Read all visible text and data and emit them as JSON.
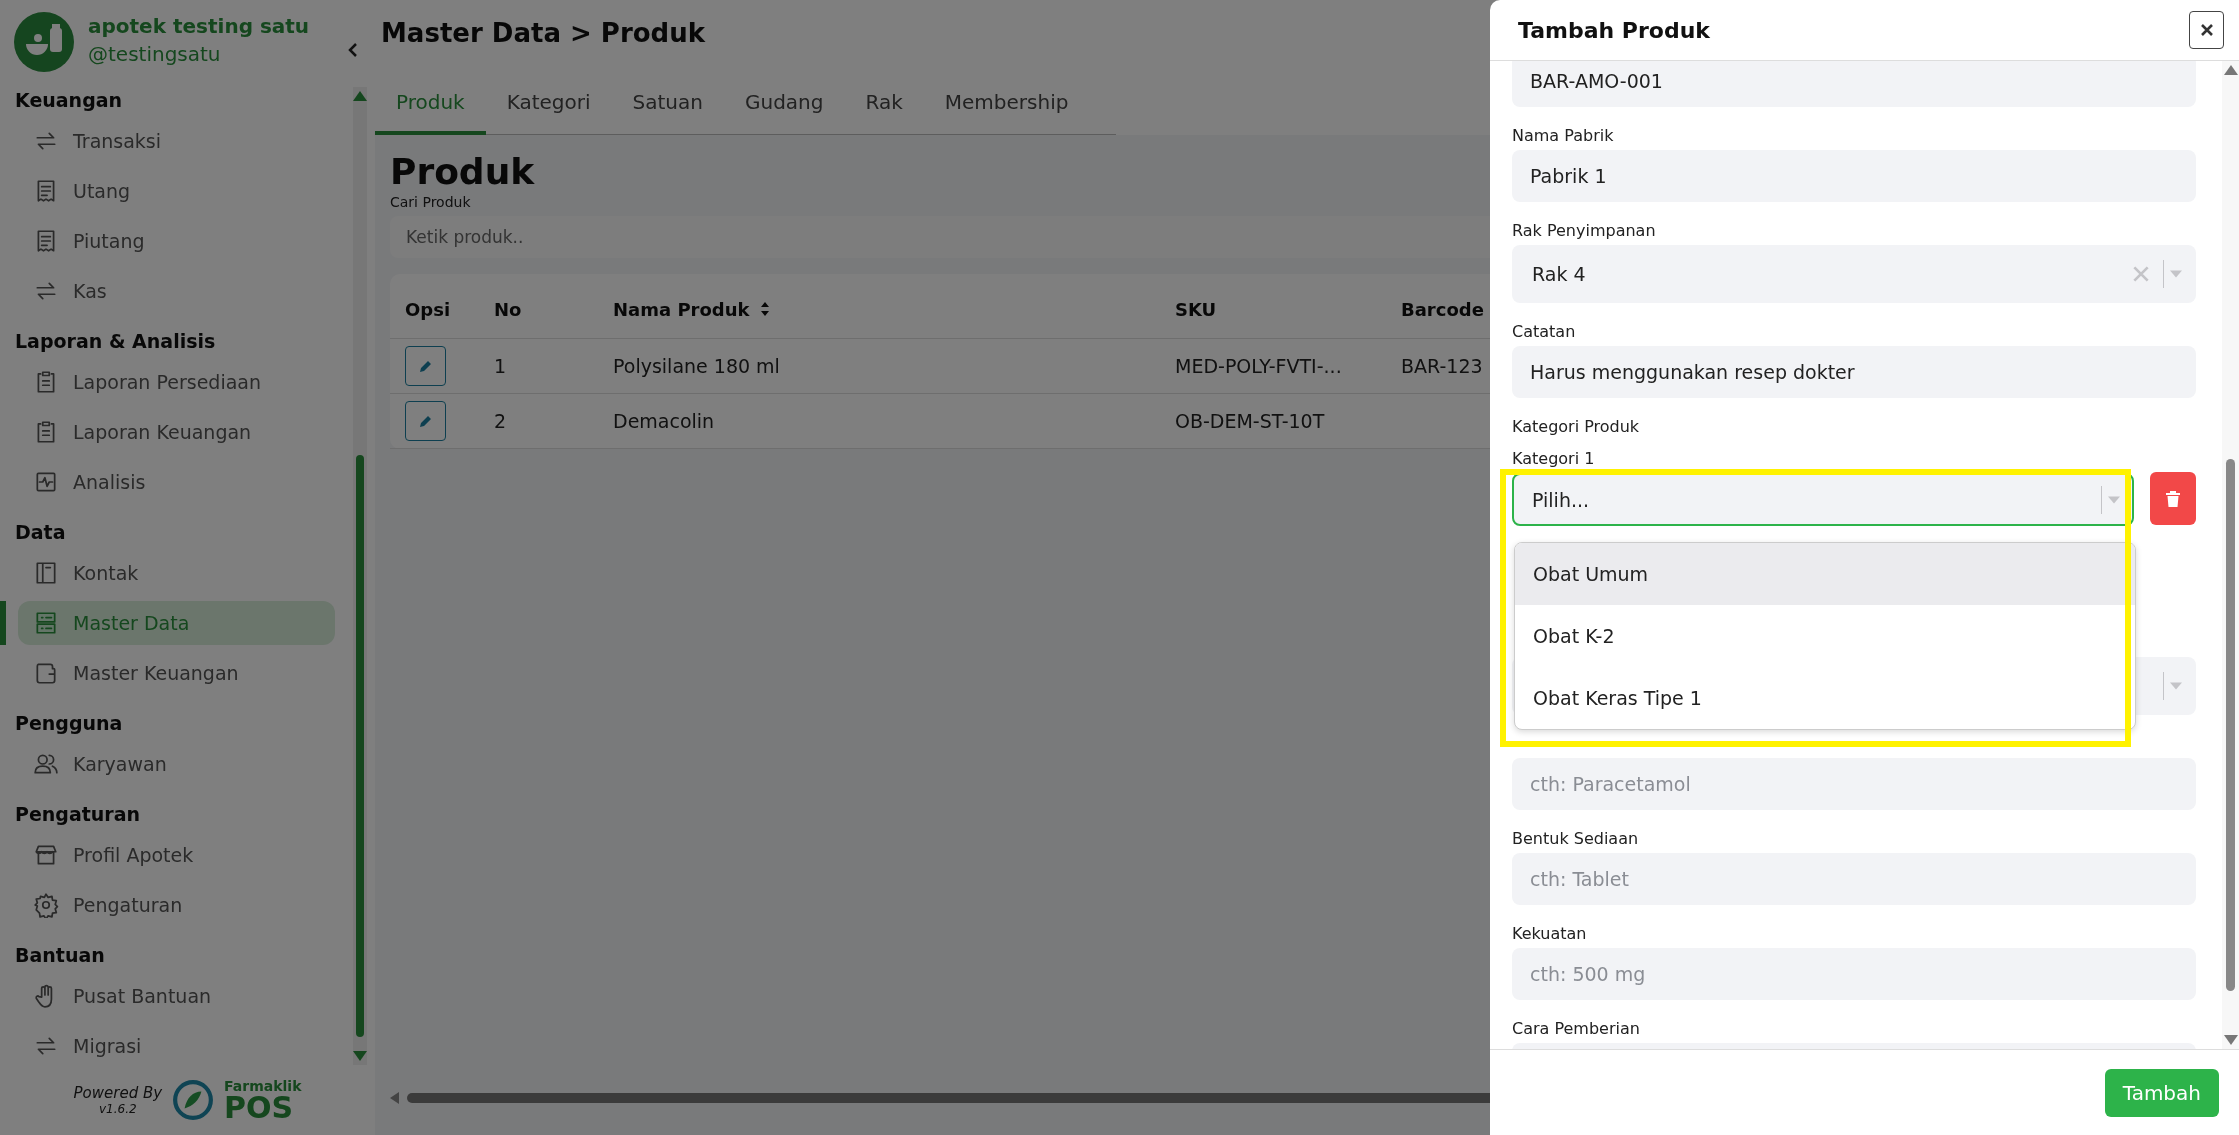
{
  "sidebar": {
    "brand": {
      "name": "apotek testing satu",
      "handle": "@testingsatu"
    },
    "sections": [
      {
        "title": "Keuangan",
        "items": [
          {
            "label": "Transaksi",
            "kind": "transfer",
            "selected": false
          },
          {
            "label": "Utang",
            "kind": "receipt",
            "selected": false
          },
          {
            "label": "Piutang",
            "kind": "receipt",
            "selected": false
          },
          {
            "label": "Kas",
            "kind": "transfer",
            "selected": false
          }
        ]
      },
      {
        "title": "Laporan & Analisis",
        "items": [
          {
            "label": "Laporan Persediaan",
            "kind": "clipboard",
            "selected": false
          },
          {
            "label": "Laporan Keuangan",
            "kind": "clipboard",
            "selected": false
          },
          {
            "label": "Analisis",
            "kind": "pulse",
            "selected": false
          }
        ]
      },
      {
        "title": "Data",
        "items": [
          {
            "label": "Kontak",
            "kind": "book",
            "selected": false
          },
          {
            "label": "Master Data",
            "kind": "database",
            "selected": true
          },
          {
            "label": "Master Keuangan",
            "kind": "wallet",
            "selected": false
          }
        ]
      },
      {
        "title": "Pengguna",
        "items": [
          {
            "label": "Karyawan",
            "kind": "users",
            "selected": false
          }
        ]
      },
      {
        "title": "Pengaturan",
        "items": [
          {
            "label": "Profil Apotek",
            "kind": "store",
            "selected": false
          },
          {
            "label": "Pengaturan",
            "kind": "gear",
            "selected": false
          }
        ]
      },
      {
        "title": "Bantuan",
        "items": [
          {
            "label": "Pusat Bantuan",
            "kind": "hand",
            "selected": false
          },
          {
            "label": "Migrasi",
            "kind": "transfer",
            "selected": false
          }
        ]
      }
    ],
    "footer": {
      "powered_by": "Powered By",
      "version": "v1.6.2",
      "logo_top": "Farmaklik",
      "logo_bottom": "POS"
    }
  },
  "page": {
    "breadcrumb": "Master Data > Produk",
    "tabs": [
      {
        "label": "Produk",
        "selected": true
      },
      {
        "label": "Kategori",
        "selected": false
      },
      {
        "label": "Satuan",
        "selected": false
      },
      {
        "label": "Gudang",
        "selected": false
      },
      {
        "label": "Rak",
        "selected": false
      },
      {
        "label": "Membership",
        "selected": false
      }
    ],
    "heading": "Produk",
    "search": {
      "label": "Cari Produk",
      "placeholder": "Ketik produk.."
    },
    "table": {
      "columns": [
        {
          "label": "Opsi",
          "sortable": false
        },
        {
          "label": "No",
          "sortable": false
        },
        {
          "label": "Nama Produk",
          "sortable": true
        },
        {
          "label": "SKU",
          "sortable": false
        },
        {
          "label": "Barcode"
        }
      ],
      "rows": [
        {
          "no": "1",
          "name": "Polysilane 180 ml",
          "sku": "MED-POLY-FVTI-...",
          "barcode": "BAR-123"
        },
        {
          "no": "2",
          "name": "Demacolin",
          "sku": "OB-DEM-ST-10T"
        }
      ]
    }
  },
  "modal": {
    "title": "Tambah Produk",
    "fields": [
      {
        "kind": "input",
        "value": "BAR-AMO-001"
      },
      {
        "kind": "input",
        "label": "Nama Pabrik",
        "value": "Pabrik 1"
      },
      {
        "kind": "select",
        "label": "Rak Penyimpanan",
        "value": "Rak 4",
        "clearable": true
      },
      {
        "kind": "input",
        "label": "Catatan",
        "value": "Harus menggunakan resep dokter"
      },
      {
        "kind": "heading",
        "label": "Kategori Produk"
      },
      {
        "kind": "category",
        "label": "Kategori 1",
        "placeholder": "Pilih...",
        "focused": true,
        "highlight": true,
        "options": [
          {
            "label": "Obat Umum",
            "highlighted": true
          },
          {
            "label": "Obat K-2",
            "highlighted": false
          },
          {
            "label": "Obat Keras Tipe 1",
            "highlighted": false
          }
        ]
      },
      {
        "kind": "select"
      },
      {
        "kind": "input",
        "placeholder": "cth: Paracetamol"
      },
      {
        "kind": "input",
        "label": "Bentuk Sediaan",
        "placeholder": "cth: Tablet"
      },
      {
        "kind": "input",
        "label": "Kekuatan",
        "placeholder": "cth: 500 mg"
      },
      {
        "kind": "input",
        "label": "Cara Pemberian"
      }
    ],
    "submit": "Tambah"
  }
}
